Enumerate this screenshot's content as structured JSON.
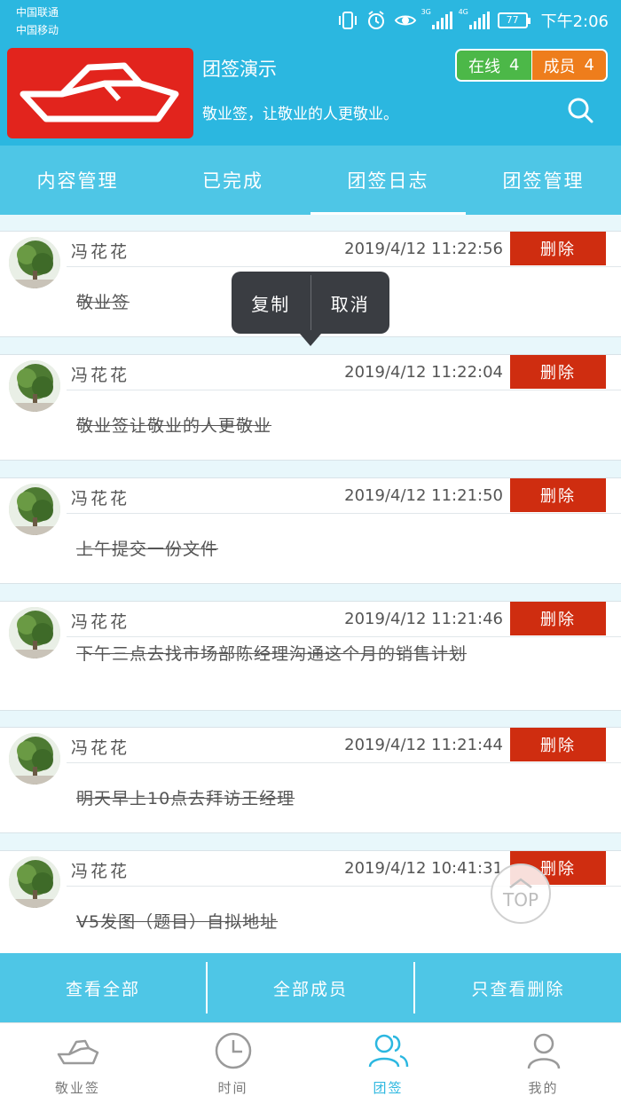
{
  "status_bar": {
    "carrier1": "中国联通",
    "carrier2": "中国移动",
    "sig1_tag": "3G",
    "sig2_tag": "4G",
    "battery": "77",
    "time": "下午2:06"
  },
  "header": {
    "title": "团签演示",
    "slogan": "敬业签，让敬业的人更敬业。",
    "online_label": "在线",
    "online_count": "4",
    "members_label": "成员",
    "members_count": "4"
  },
  "tabs": [
    {
      "label": "内容管理"
    },
    {
      "label": "已完成"
    },
    {
      "label": "团签日志"
    },
    {
      "label": "团签管理"
    }
  ],
  "active_tab": "团签日志",
  "delete_label": "删除",
  "entries": [
    {
      "name": "冯花花",
      "time": "2019/4/12  11:22:56",
      "text": "敬业签"
    },
    {
      "name": "冯花花",
      "time": "2019/4/12  11:22:04",
      "text": "敬业签让敬业的人更敬业"
    },
    {
      "name": "冯花花",
      "time": "2019/4/12  11:21:50",
      "text": "上午提交一份文件"
    },
    {
      "name": "冯花花",
      "time": "2019/4/12  11:21:46",
      "text": "下午三点去找市场部陈经理沟通这个月的销售计划"
    },
    {
      "name": "冯花花",
      "time": "2019/4/12  11:21:44",
      "text": "明天早上10点去拜访王经理"
    },
    {
      "name": "冯花花",
      "time": "2019/4/12  10:41:31",
      "text": "V5发图（题目）自拟地址"
    }
  ],
  "popup": {
    "copy": "复制",
    "cancel": "取消"
  },
  "top_button": "TOP",
  "actions": {
    "view_all": "查看全部",
    "all_members": "全部成员",
    "only_deleted": "只查看删除"
  },
  "tabbar": [
    {
      "label": "敬业签",
      "icon": "jingyeqian-logo-icon"
    },
    {
      "label": "时间",
      "icon": "clock-icon"
    },
    {
      "label": "团签",
      "icon": "team-icon"
    },
    {
      "label": "我的",
      "icon": "person-icon"
    }
  ],
  "colors": {
    "primary": "#2bb7e0",
    "tab_bar": "#4ec6e6",
    "delete": "#cf2d10",
    "online": "#4cb848",
    "members": "#ee7d1c"
  }
}
